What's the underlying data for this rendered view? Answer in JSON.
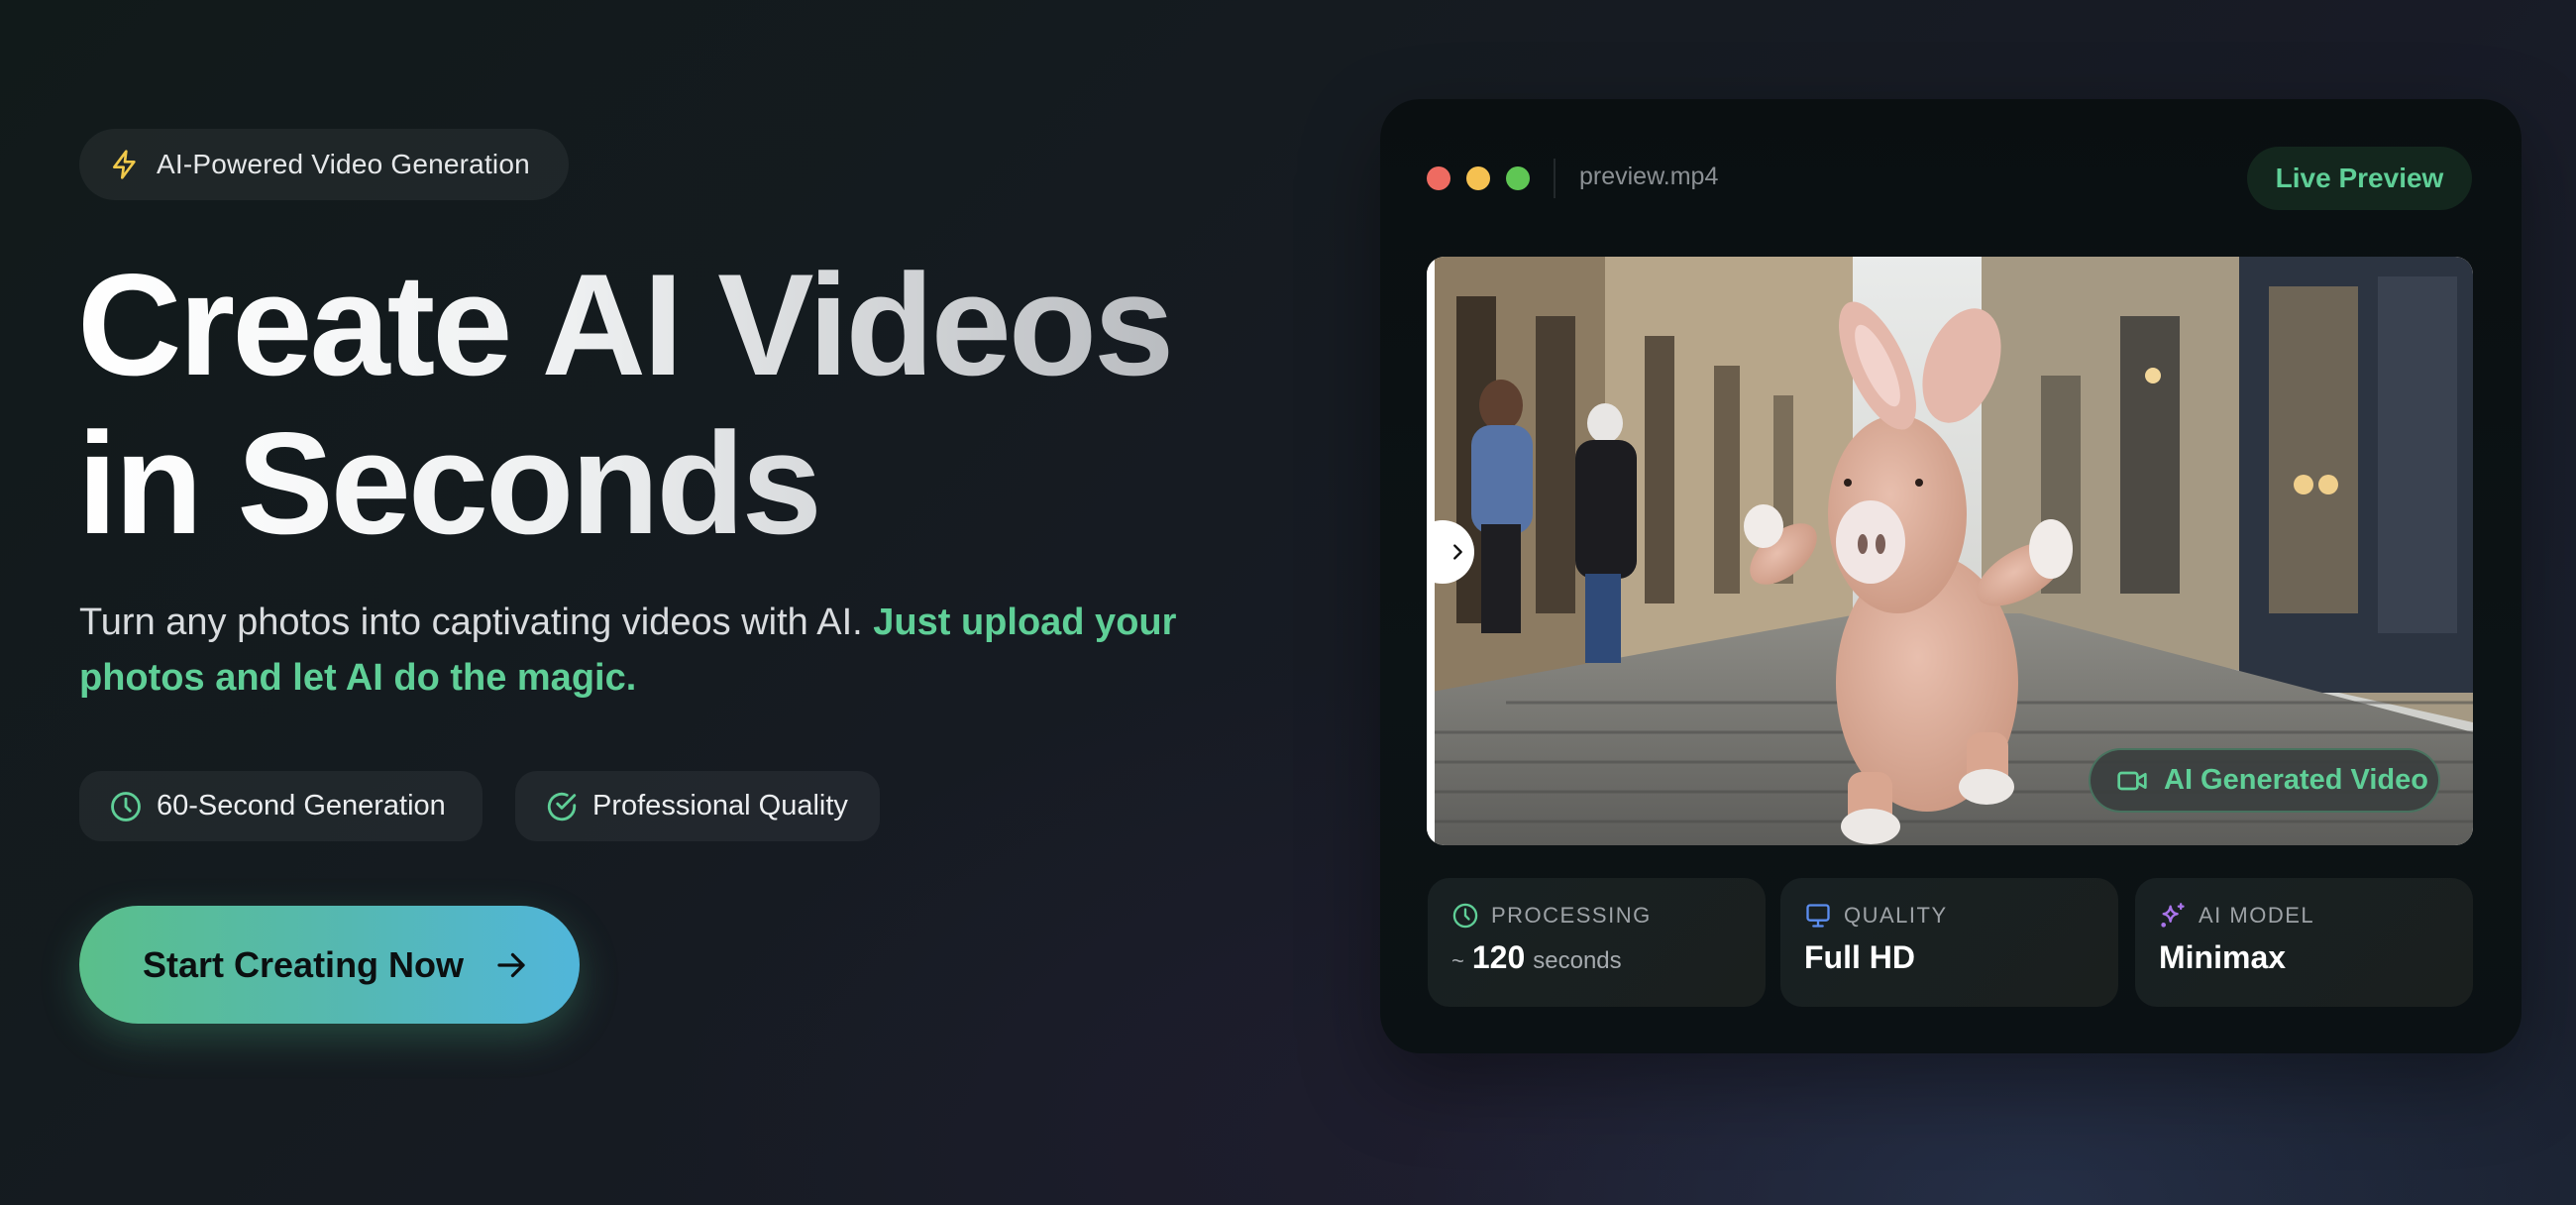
{
  "hero": {
    "badge": {
      "icon": "lightning-icon",
      "label": "AI-Powered Video Generation"
    },
    "headline": {
      "line1": "Create AI Videos",
      "line2": "in Seconds"
    },
    "subtitle": {
      "plain": "Turn any photos into captivating videos with AI. ",
      "accent": "Just upload your photos and let AI do the magic."
    },
    "features": [
      {
        "icon": "clock-icon",
        "label": "60-Second Generation"
      },
      {
        "icon": "check-circle-icon",
        "label": "Professional Quality"
      }
    ],
    "cta": {
      "label": "Start Creating Now",
      "icon": "arrow-right-icon"
    }
  },
  "preview": {
    "window_controls": [
      "close",
      "minimize",
      "maximize"
    ],
    "filename": "preview.mp4",
    "live_label": "Live Preview",
    "media_badge": {
      "icon": "video-camera-icon",
      "label": "AI Generated Video"
    },
    "media_description": "Plush pink pig walking on a cobblestone city street with pedestrians",
    "stats": [
      {
        "icon": "clock-icon",
        "label": "PROCESSING",
        "prefix": "~",
        "value": "120",
        "unit": "seconds"
      },
      {
        "icon": "monitor-icon",
        "label": "QUALITY",
        "value": "Full HD"
      },
      {
        "icon": "sparkles-icon",
        "label": "AI MODEL",
        "value": "Minimax"
      }
    ]
  },
  "colors": {
    "accent_green": "#5fcf97",
    "cta_gradient_start": "#5abf8a",
    "cta_gradient_end": "#51b6da",
    "lightning_yellow": "#f0c94a",
    "monitor_blue": "#5b8def",
    "sparkles_purple": "#a874ea",
    "dot_red": "#ee6b61",
    "dot_yellow": "#f5c151",
    "dot_green": "#5fc654"
  }
}
